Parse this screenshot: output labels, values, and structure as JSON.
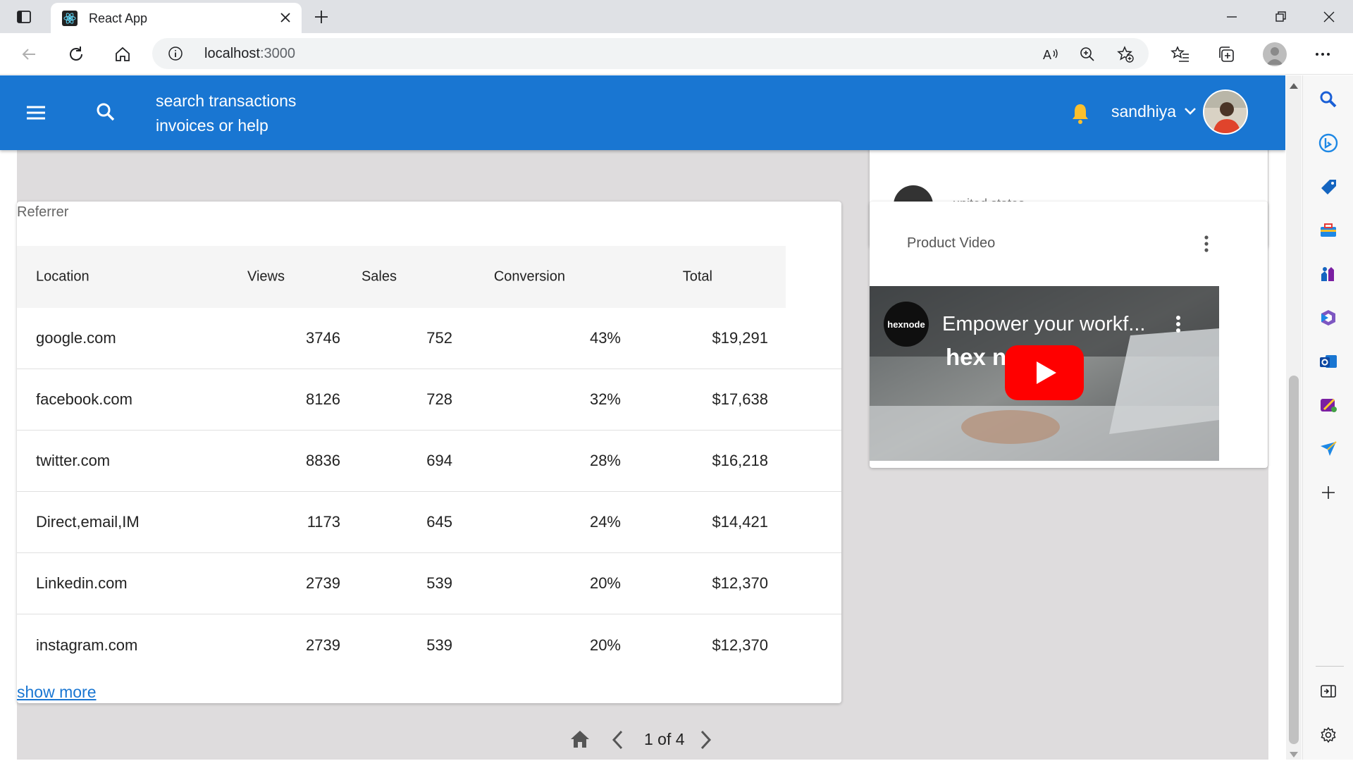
{
  "browser": {
    "tab_title": "React App",
    "url_host": "localhost",
    "url_port": ":3000"
  },
  "appbar": {
    "search_hint_line1": "search transactions",
    "search_hint_line2": "invoices or help",
    "username": "sandhiya",
    "color": "#1976d2",
    "bell_color": "#fbc02d"
  },
  "peek_card": {
    "text": "united states"
  },
  "referrer": {
    "title": "Referrer",
    "columns": [
      "Location",
      "Views",
      "Sales",
      "Conversion",
      "Total"
    ],
    "rows": [
      {
        "location": "google.com",
        "views": "3746",
        "sales": "752",
        "conversion": "43%",
        "total": "$19,291"
      },
      {
        "location": "facebook.com",
        "views": "8126",
        "sales": "728",
        "conversion": "32%",
        "total": "$17,638"
      },
      {
        "location": "twitter.com",
        "views": "8836",
        "sales": "694",
        "conversion": "28%",
        "total": "$16,218"
      },
      {
        "location": "Direct,email,IM",
        "views": "1173",
        "sales": "645",
        "conversion": "24%",
        "total": "$14,421"
      },
      {
        "location": "Linkedin.com",
        "views": "2739",
        "sales": "539",
        "conversion": "20%",
        "total": "$12,370"
      },
      {
        "location": "instagram.com",
        "views": "2739",
        "sales": "539",
        "conversion": "20%",
        "total": "$12,370"
      }
    ],
    "show_more": "show more"
  },
  "product_video": {
    "title": "Product Video",
    "channel_logo": "hexnode",
    "video_title": "Empower your workf...",
    "brand_text": "hex       ndm"
  },
  "pager": {
    "text": "1 of 4"
  },
  "icons": {
    "sidebar": [
      "search-icon",
      "bing-icon",
      "shopping-tag-icon",
      "tools-icon",
      "games-icon",
      "office-icon",
      "outlook-icon",
      "designer-icon",
      "send-icon",
      "add-icon",
      "sidebar-toggle-icon",
      "settings-icon"
    ]
  }
}
